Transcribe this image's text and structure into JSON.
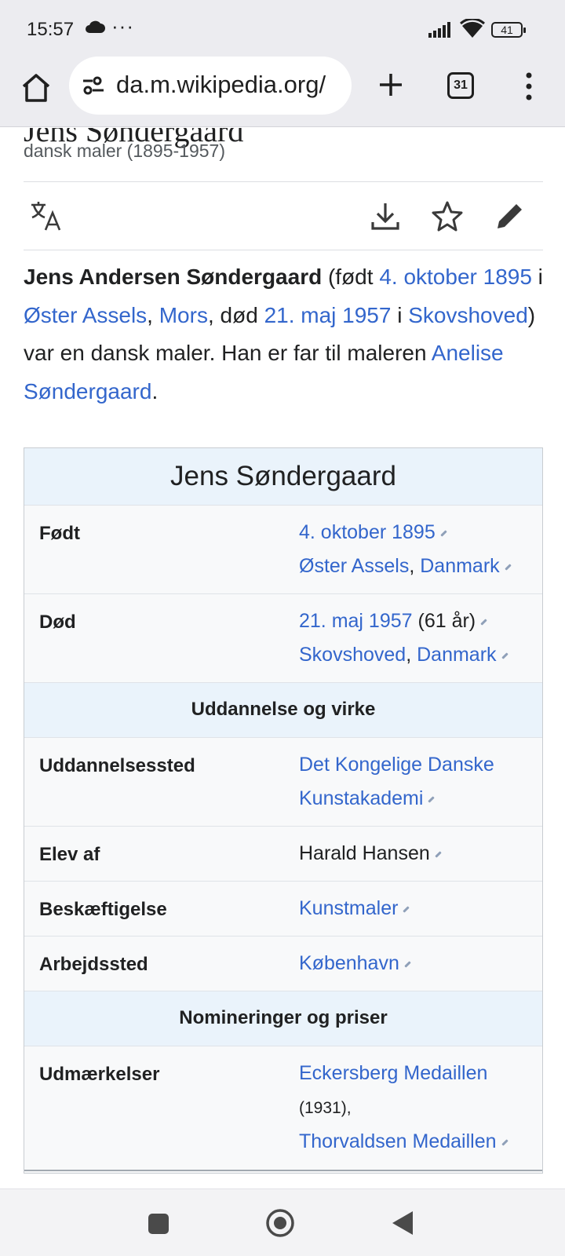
{
  "status_bar": {
    "time": "15:57",
    "dots": "···",
    "battery": "41"
  },
  "browser": {
    "url": "da.m.wikipedia.org/",
    "tab_count": "31"
  },
  "article": {
    "title_fragment": "Jens Søndergaard",
    "subtitle": "dansk maler (1895-1957)",
    "intro": [
      {
        "t": "Jens Andersen Søndergaard",
        "k": "b"
      },
      {
        "t": " (født ",
        "k": "t"
      },
      {
        "t": "4. oktober 1895",
        "k": "l"
      },
      {
        "t": " i ",
        "k": "t"
      },
      {
        "t": "Øster Assels",
        "k": "l"
      },
      {
        "t": ", ",
        "k": "t"
      },
      {
        "t": "Mors",
        "k": "l"
      },
      {
        "t": ", død ",
        "k": "t"
      },
      {
        "t": "21. maj 1957",
        "k": "l"
      },
      {
        "t": " i ",
        "k": "t"
      },
      {
        "t": "Skovshoved",
        "k": "l"
      },
      {
        "t": ") var en dansk maler. Han er far til maleren ",
        "k": "t"
      },
      {
        "t": "Anelise Søndergaard",
        "k": "l"
      },
      {
        "t": ".",
        "k": "t"
      }
    ]
  },
  "infobox": {
    "title": "Jens Søndergaard",
    "born": {
      "label": "Født",
      "date": "4. oktober 1895",
      "place": "Øster Assels",
      "sep": ", ",
      "country": "Danmark"
    },
    "died": {
      "label": "Død",
      "date": "21. maj 1957",
      "age": " (61 år)",
      "place": "Skovshoved",
      "sep": ", ",
      "country": "Danmark"
    },
    "section_education": "Uddannelse og virke",
    "education": {
      "label": "Uddannelsessted",
      "value": "Det Kongelige Danske Kunstakademi"
    },
    "student_of": {
      "label": "Elev af",
      "value": "Harald Hansen"
    },
    "occupation": {
      "label": "Beskæftigelse",
      "value": "Kunstmaler"
    },
    "workplace": {
      "label": "Arbejdssted",
      "value": "København"
    },
    "section_awards": "Nomineringer og priser",
    "awards": {
      "label": "Udmærkelser",
      "award1": "Eckersberg Medaillen",
      "award1_year": "(1931),",
      "award2": "Thorvaldsen Medaillen"
    }
  },
  "icons": {
    "home": "home-icon",
    "tune": "site-settings-icon",
    "plus": "new-tab-icon",
    "menu": "more-vert-icon",
    "translate": "translate-icon",
    "download": "download-icon",
    "star": "star-icon",
    "edit": "pencil-icon"
  },
  "colors": {
    "link": "#3366cc",
    "infobox_header": "#eaf3fb",
    "chrome_bar": "#ececf0"
  }
}
